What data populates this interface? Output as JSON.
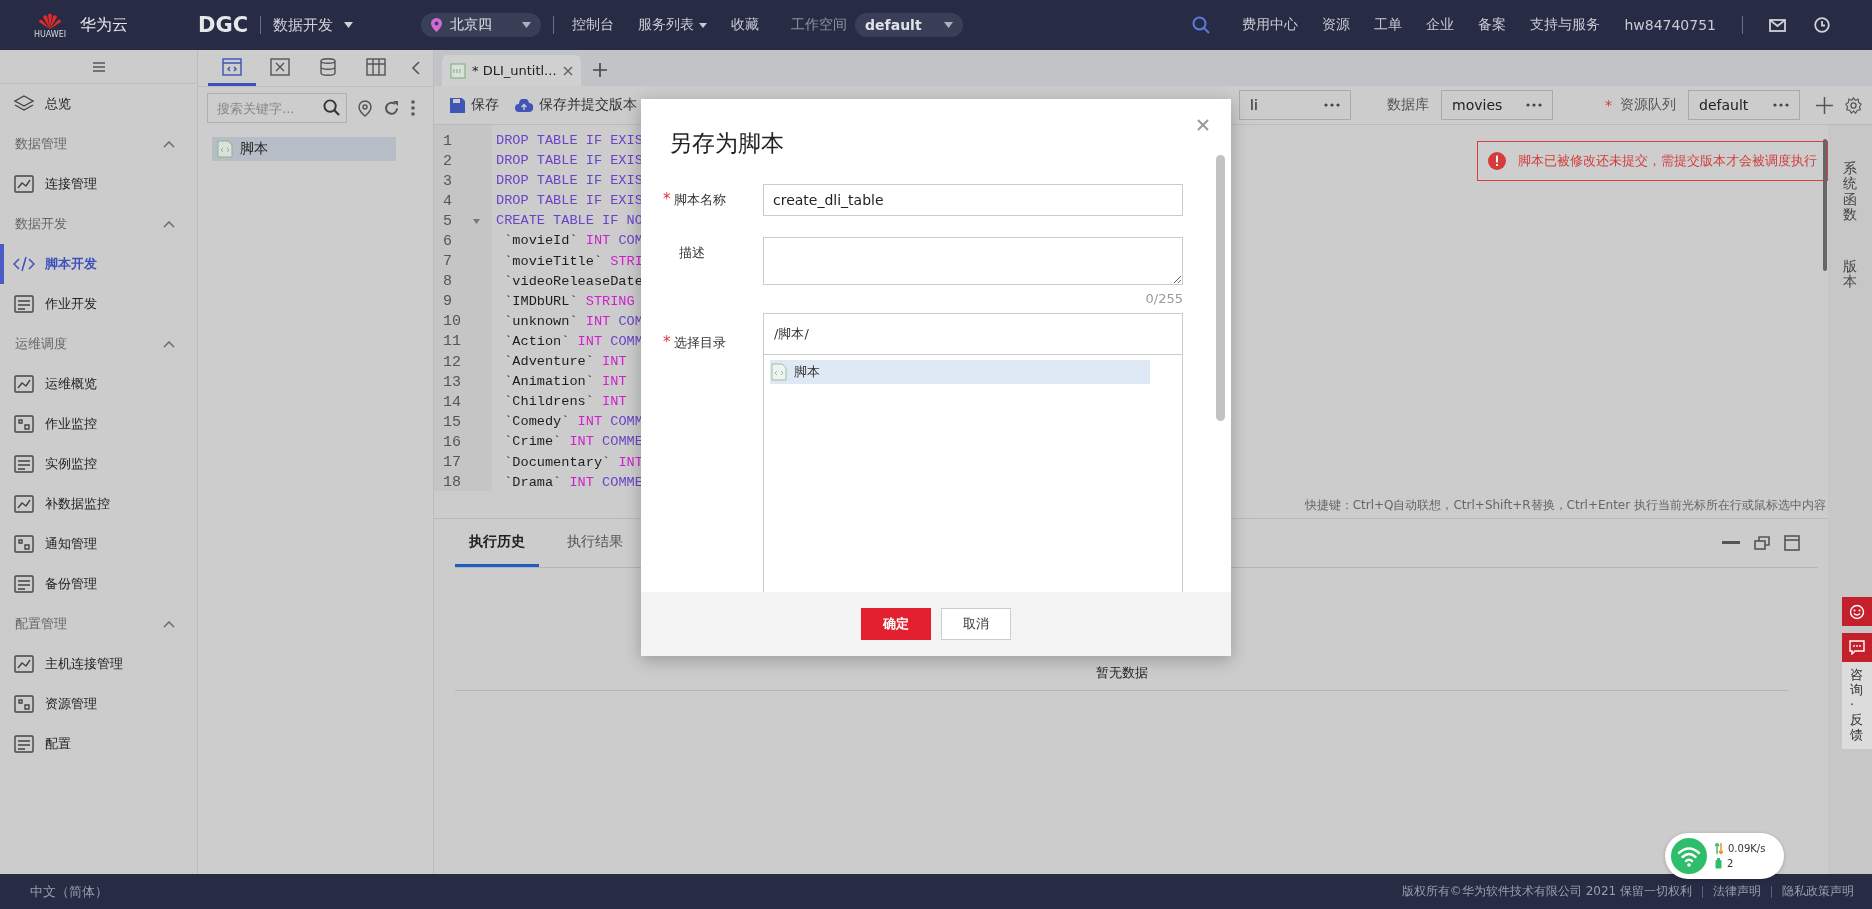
{
  "top_bar": {
    "logo_caption": "HUAWEI",
    "brand": "华为云",
    "product": "DGC",
    "module": "数据开发",
    "region": "北京四",
    "nav": [
      {
        "label": "控制台",
        "dropdown": false
      },
      {
        "label": "服务列表",
        "dropdown": true
      },
      {
        "label": "收藏",
        "dropdown": false
      }
    ],
    "workspace_label": "工作空间",
    "workspace": "default",
    "links": [
      "费用中心",
      "资源",
      "工单",
      "企业",
      "备案",
      "支持与服务",
      "hw84740751"
    ]
  },
  "sidebar": {
    "items": [
      {
        "kind": "link",
        "label": "总览",
        "selected": false
      },
      {
        "kind": "section",
        "label": "数据管理",
        "expanded": true,
        "children": [
          {
            "label": "连接管理",
            "selected": false
          }
        ]
      },
      {
        "kind": "section",
        "label": "数据开发",
        "expanded": true,
        "children": [
          {
            "label": "脚本开发",
            "selected": true
          },
          {
            "label": "作业开发",
            "selected": false
          }
        ]
      },
      {
        "kind": "section",
        "label": "运维调度",
        "expanded": true,
        "children": [
          {
            "label": "运维概览",
            "selected": false
          },
          {
            "label": "作业监控",
            "selected": false
          },
          {
            "label": "实例监控",
            "selected": false
          },
          {
            "label": "补数据监控",
            "selected": false
          },
          {
            "label": "通知管理",
            "selected": false
          },
          {
            "label": "备份管理",
            "selected": false
          }
        ]
      },
      {
        "kind": "section",
        "label": "配置管理",
        "expanded": true,
        "children": [
          {
            "label": "主机连接管理",
            "selected": false
          },
          {
            "label": "资源管理",
            "selected": false
          },
          {
            "label": "配置",
            "selected": false
          }
        ]
      }
    ]
  },
  "explorer": {
    "tabs": [
      {
        "selected": true
      },
      {
        "selected": false
      },
      {
        "selected": false
      },
      {
        "selected": false
      }
    ],
    "search": {
      "placeholder": "搜索关键字..."
    },
    "tree": [
      {
        "label": "脚本",
        "selected": true
      }
    ]
  },
  "editor": {
    "tabs": [
      {
        "label": "* DLI_untitl...",
        "selected": true
      }
    ],
    "toolbar": [
      "保存",
      "保存并提交版本"
    ],
    "connection": {
      "value": "li"
    },
    "database": {
      "label": "数据库",
      "value": "movies"
    },
    "queue": {
      "mark": "*",
      "label": "资源队列",
      "value": "default"
    },
    "lines": [
      {
        "n": "1",
        "parts": [
          {
            "kind": "keyword",
            "text": "DROP TABLE IF EXIS"
          }
        ]
      },
      {
        "n": "2",
        "parts": [
          {
            "kind": "keyword",
            "text": "DROP TABLE IF EXIS"
          }
        ]
      },
      {
        "n": "3",
        "parts": [
          {
            "kind": "keyword",
            "text": "DROP TABLE IF EXIS"
          }
        ]
      },
      {
        "n": "4",
        "parts": [
          {
            "kind": "keyword",
            "text": "DROP TABLE IF EXIS"
          }
        ]
      },
      {
        "n": "5",
        "foldable": true,
        "parts": [
          {
            "kind": "keyword",
            "text": "CREATE TABLE IF NO"
          }
        ]
      },
      {
        "n": "6",
        "parts": [
          {
            "kind": "ident",
            "text": " `movieId` "
          },
          {
            "kind": "type",
            "text": "INT "
          },
          {
            "kind": "keyword",
            "text": "COM"
          }
        ]
      },
      {
        "n": "7",
        "parts": [
          {
            "kind": "ident",
            "text": " `movieTitle` "
          },
          {
            "kind": "type",
            "text": "STRI"
          }
        ]
      },
      {
        "n": "8",
        "parts": [
          {
            "kind": "ident",
            "text": " `videoReleaseDate"
          }
        ]
      },
      {
        "n": "9",
        "parts": [
          {
            "kind": "ident",
            "text": " `IMDbURL` "
          },
          {
            "kind": "type",
            "text": "STRING"
          }
        ]
      },
      {
        "n": "10",
        "parts": [
          {
            "kind": "ident",
            "text": " `unknown` "
          },
          {
            "kind": "type",
            "text": "INT "
          },
          {
            "kind": "keyword",
            "text": "COM"
          }
        ]
      },
      {
        "n": "11",
        "parts": [
          {
            "kind": "ident",
            "text": " `Action` "
          },
          {
            "kind": "type",
            "text": "INT "
          },
          {
            "kind": "keyword",
            "text": "COMM"
          }
        ]
      },
      {
        "n": "12",
        "parts": [
          {
            "kind": "ident",
            "text": " `Adventure` "
          },
          {
            "kind": "type",
            "text": "INT"
          }
        ]
      },
      {
        "n": "13",
        "parts": [
          {
            "kind": "ident",
            "text": " `Animation` "
          },
          {
            "kind": "type",
            "text": "INT"
          }
        ]
      },
      {
        "n": "14",
        "parts": [
          {
            "kind": "ident",
            "text": " `Childrens` "
          },
          {
            "kind": "type",
            "text": "INT"
          }
        ]
      },
      {
        "n": "15",
        "parts": [
          {
            "kind": "ident",
            "text": " `Comedy` "
          },
          {
            "kind": "type",
            "text": "INT "
          },
          {
            "kind": "keyword",
            "text": "COMM"
          }
        ]
      },
      {
        "n": "16",
        "parts": [
          {
            "kind": "ident",
            "text": " `Crime` "
          },
          {
            "kind": "type",
            "text": "INT "
          },
          {
            "kind": "keyword",
            "text": "COMME"
          }
        ]
      },
      {
        "n": "17",
        "parts": [
          {
            "kind": "ident",
            "text": " `Documentary` "
          },
          {
            "kind": "type",
            "text": "INT"
          }
        ]
      },
      {
        "n": "18",
        "parts": [
          {
            "kind": "ident",
            "text": " `Drama` "
          },
          {
            "kind": "type",
            "text": "INT "
          },
          {
            "kind": "keyword",
            "text": "COMME"
          }
        ]
      }
    ],
    "notice": "脚本已被修改还未提交，需提交版本才会被调度执行",
    "hint": "快捷键：Ctrl+Q自动联想，Ctrl+Shift+R替换，Ctrl+Enter 执行当前光标所在行或鼠标选中内容"
  },
  "results": {
    "tabs": [
      {
        "label": "执行历史",
        "selected": true
      },
      {
        "label": "执行结果",
        "selected": false
      }
    ],
    "empty": "暂无数据"
  },
  "side_panel": [
    "系统函数",
    "版本"
  ],
  "feedback": {
    "label": "咨询·反馈"
  },
  "network": {
    "speed": "0.09K/s",
    "count": "2"
  },
  "dialog": {
    "title": "另存为脚本",
    "fields": [
      {
        "kind": "input",
        "mark": "*",
        "label": "脚本名称",
        "value": "create_dli_table"
      },
      {
        "kind": "textarea",
        "label": "描述",
        "counter": "0/255"
      },
      {
        "kind": "tree",
        "mark": "*",
        "label": "选择目录",
        "path": "/脚本/",
        "items": [
          {
            "label": "脚本",
            "selected": true
          }
        ]
      }
    ],
    "buttons": [
      {
        "label": "确定",
        "kind": "primary"
      },
      {
        "label": "取消",
        "kind": "secondary"
      }
    ]
  },
  "footer": {
    "language": "中文（简体）",
    "copyright": "版权所有©华为软件技术有限公司 2021 保留一切权利",
    "links": [
      "法律声明",
      "隐私政策声明"
    ]
  }
}
